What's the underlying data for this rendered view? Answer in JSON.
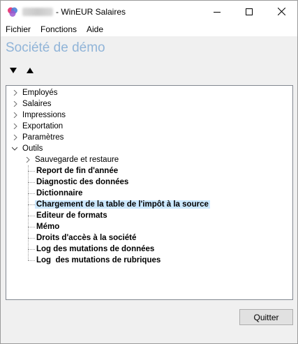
{
  "window": {
    "title": "- WinEUR Salaires",
    "minimize_icon": "minimize-icon",
    "maximize_icon": "maximize-icon",
    "close_icon": "close-icon"
  },
  "menu": {
    "items": [
      "Fichier",
      "Fonctions",
      "Aide"
    ]
  },
  "company_name": "Société de démo",
  "colors": {
    "company_title": "#90b4d8",
    "selection": "#cce8ff"
  },
  "tree": {
    "top_items": [
      "Employés",
      "Salaires",
      "Impressions",
      "Exportation",
      "Paramètres",
      "Outils"
    ],
    "outils_children": {
      "group": "Sauvegarde et restaure",
      "items": [
        "Report de fin d'année",
        "Diagnostic des données",
        "Dictionnaire",
        "Chargement de la table de l'impôt à la source",
        "Editeur de formats",
        "Mémo",
        "Droits d'accès à la société",
        "Log des mutations de données",
        "Log  des mutations de rubriques"
      ],
      "selected": "Chargement de la table de l'impôt à la source"
    }
  },
  "buttons": {
    "quit": "Quitter"
  }
}
